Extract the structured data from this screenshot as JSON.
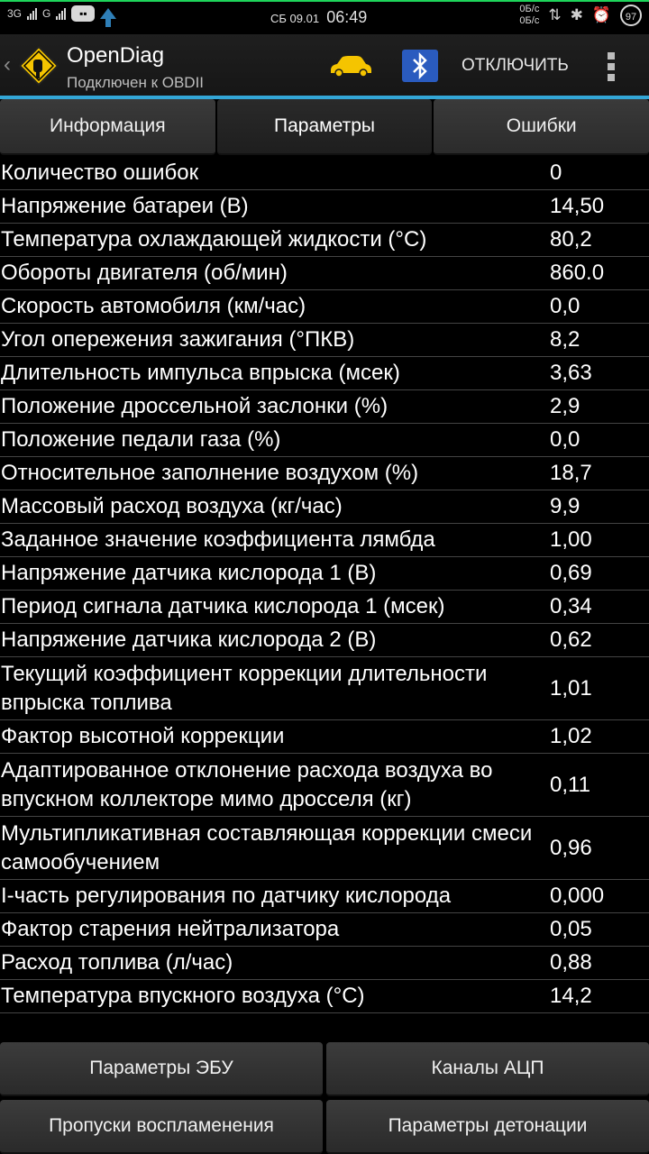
{
  "status_bar": {
    "network1": "3G",
    "network2": "G",
    "date": "СБ 09.01",
    "time": "06:49",
    "speed_up": "0Б/с",
    "speed_down": "0Б/с",
    "battery": "97"
  },
  "app": {
    "title": "OpenDiag",
    "subtitle": "Подключен к OBDII",
    "disconnect_label": "ОТКЛЮЧИТЬ"
  },
  "tabs": [
    {
      "label": "Информация"
    },
    {
      "label": "Параметры"
    },
    {
      "label": "Ошибки"
    }
  ],
  "params": [
    {
      "label": "Количество ошибок",
      "value": "0"
    },
    {
      "label": "Напряжение батареи (В)",
      "value": "14,50"
    },
    {
      "label": "Температура охлаждающей жидкости (°C)",
      "value": "80,2"
    },
    {
      "label": "Обороты двигателя (об/мин)",
      "value": "860.0"
    },
    {
      "label": "Скорость автомобиля (км/час)",
      "value": "0,0"
    },
    {
      "label": "Угол опережения зажигания (°ПКВ)",
      "value": "8,2"
    },
    {
      "label": "Длительность импульса впрыска (мсек)",
      "value": "3,63"
    },
    {
      "label": "Положение дроссельной заслонки (%)",
      "value": "2,9"
    },
    {
      "label": "Положение педали газа (%)",
      "value": "0,0"
    },
    {
      "label": "Относительное заполнение воздухом (%)",
      "value": "18,7"
    },
    {
      "label": "Массовый расход воздуха (кг/час)",
      "value": "9,9"
    },
    {
      "label": "Заданное значение коэффициента лямбда",
      "value": "1,00"
    },
    {
      "label": "Напряжение датчика кислорода 1 (В)",
      "value": "0,69"
    },
    {
      "label": "Период сигнала датчика кислорода 1 (мсек)",
      "value": "0,34"
    },
    {
      "label": "Напряжение датчика кислорода 2 (В)",
      "value": "0,62"
    },
    {
      "label": "Текущий коэффициент коррекции длительности впрыска топлива",
      "value": "1,01"
    },
    {
      "label": "Фактор высотной коррекции",
      "value": "1,02"
    },
    {
      "label": "Адаптированное отклонение расхода воздуха во впускном коллекторе мимо дросселя (кг)",
      "value": "0,11"
    },
    {
      "label": "Мультипликативная составляющая коррекции смеси самообучением",
      "value": "0,96"
    },
    {
      "label": "I-часть регулирования по датчику кислорода",
      "value": "0,000"
    },
    {
      "label": "Фактор старения нейтрализатора",
      "value": "0,05"
    },
    {
      "label": "Расход топлива (л/час)",
      "value": "0,88"
    },
    {
      "label": "Температура впускного воздуха (°C)",
      "value": "14,2"
    }
  ],
  "bottom_buttons": [
    {
      "label": "Параметры ЭБУ"
    },
    {
      "label": "Каналы АЦП"
    },
    {
      "label": "Пропуски воспламенения"
    },
    {
      "label": "Параметры детонации"
    }
  ],
  "colors": {
    "accent_line": "#33a6d6",
    "car_icon": "#f5c400",
    "bluetooth_bg": "#2a5bbf",
    "top_progress": "#1ed45a"
  }
}
